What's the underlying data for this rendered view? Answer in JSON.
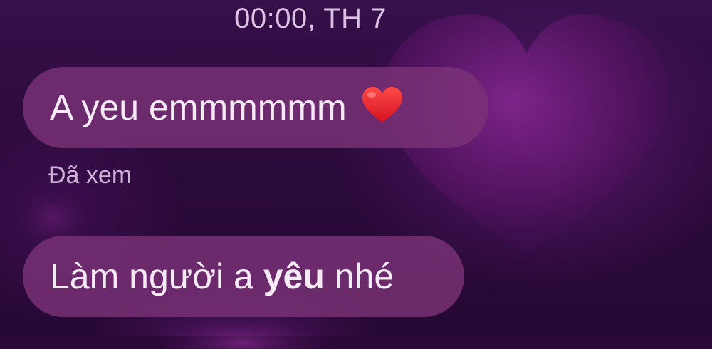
{
  "header": {
    "timestamp": "00:00, TH 7"
  },
  "messages": [
    {
      "text": "A yeu emmmmmm",
      "emoji": "heart-emoji",
      "status": "Đã xem"
    },
    {
      "text_before": "Làm người a ",
      "text_bold": "yêu",
      "text_after": " nhé"
    }
  ],
  "colors": {
    "background": "#2a0838",
    "bubble": "#7a3276",
    "bubble_text": "#f7eaf7",
    "timestamp_text": "#dcc3e6",
    "status_text": "#cdb3d8",
    "emoji_heart": "#e0222e"
  }
}
